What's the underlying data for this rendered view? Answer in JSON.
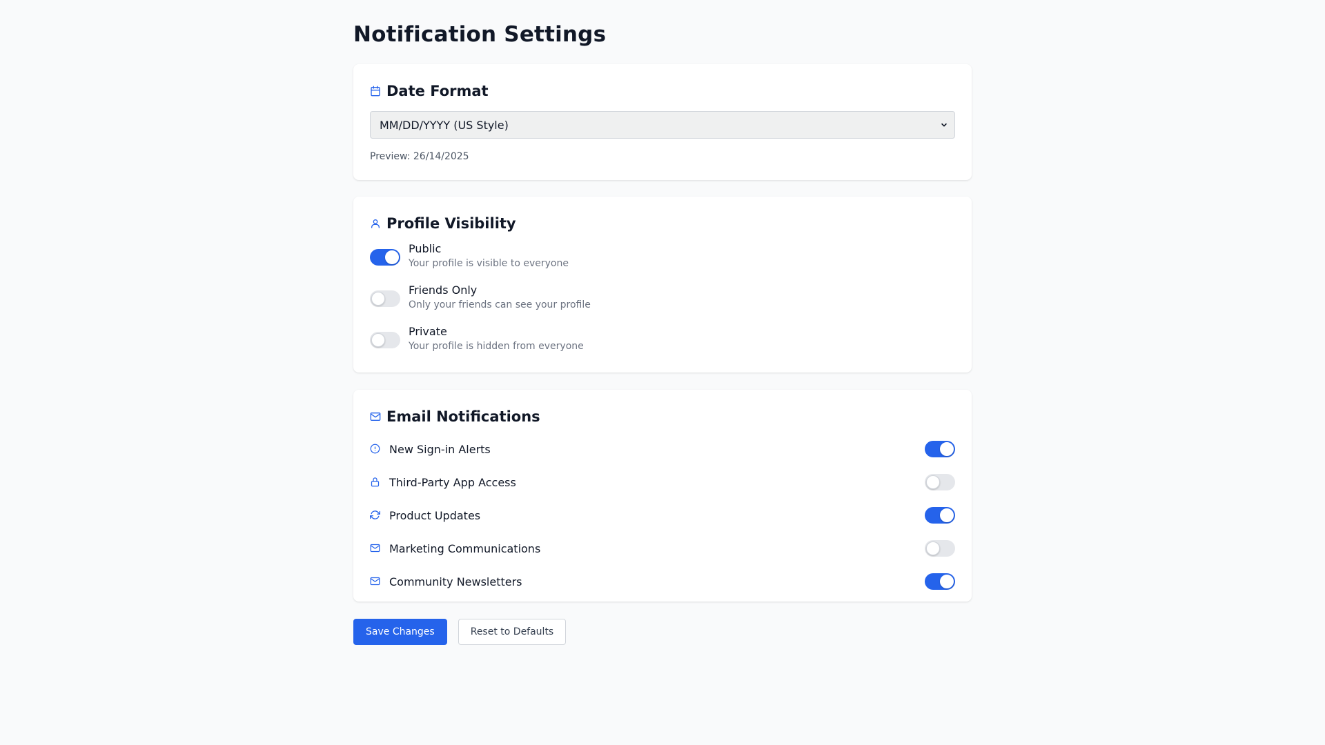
{
  "page": {
    "title": "Notification Settings"
  },
  "colors": {
    "accent": "#2563eb",
    "toggle_off": "#e5e7eb",
    "background": "#f9fafb"
  },
  "date_format": {
    "title": "Date Format",
    "icon": "calendar-icon",
    "selected": "MM/DD/YYYY (US Style)",
    "preview": "Preview: 26/14/2025"
  },
  "profile_visibility": {
    "title": "Profile Visibility",
    "icon": "user-icon",
    "options": [
      {
        "label": "Public",
        "description": "Your profile is visible to everyone",
        "enabled": true
      },
      {
        "label": "Friends Only",
        "description": "Only your friends can see your profile",
        "enabled": false
      },
      {
        "label": "Private",
        "description": "Your profile is hidden from everyone",
        "enabled": false
      }
    ]
  },
  "email_notifications": {
    "title": "Email Notifications",
    "icon": "mail-icon",
    "items": [
      {
        "label": "New Sign-in Alerts",
        "icon": "alert-circle-icon",
        "enabled": true
      },
      {
        "label": "Third-Party App Access",
        "icon": "lock-icon",
        "enabled": false
      },
      {
        "label": "Product Updates",
        "icon": "refresh-icon",
        "enabled": true
      },
      {
        "label": "Marketing Communications",
        "icon": "mail-icon",
        "enabled": false
      },
      {
        "label": "Community Newsletters",
        "icon": "mail-icon",
        "enabled": true
      }
    ]
  },
  "actions": {
    "save_label": "Save Changes",
    "reset_label": "Reset to Defaults"
  }
}
